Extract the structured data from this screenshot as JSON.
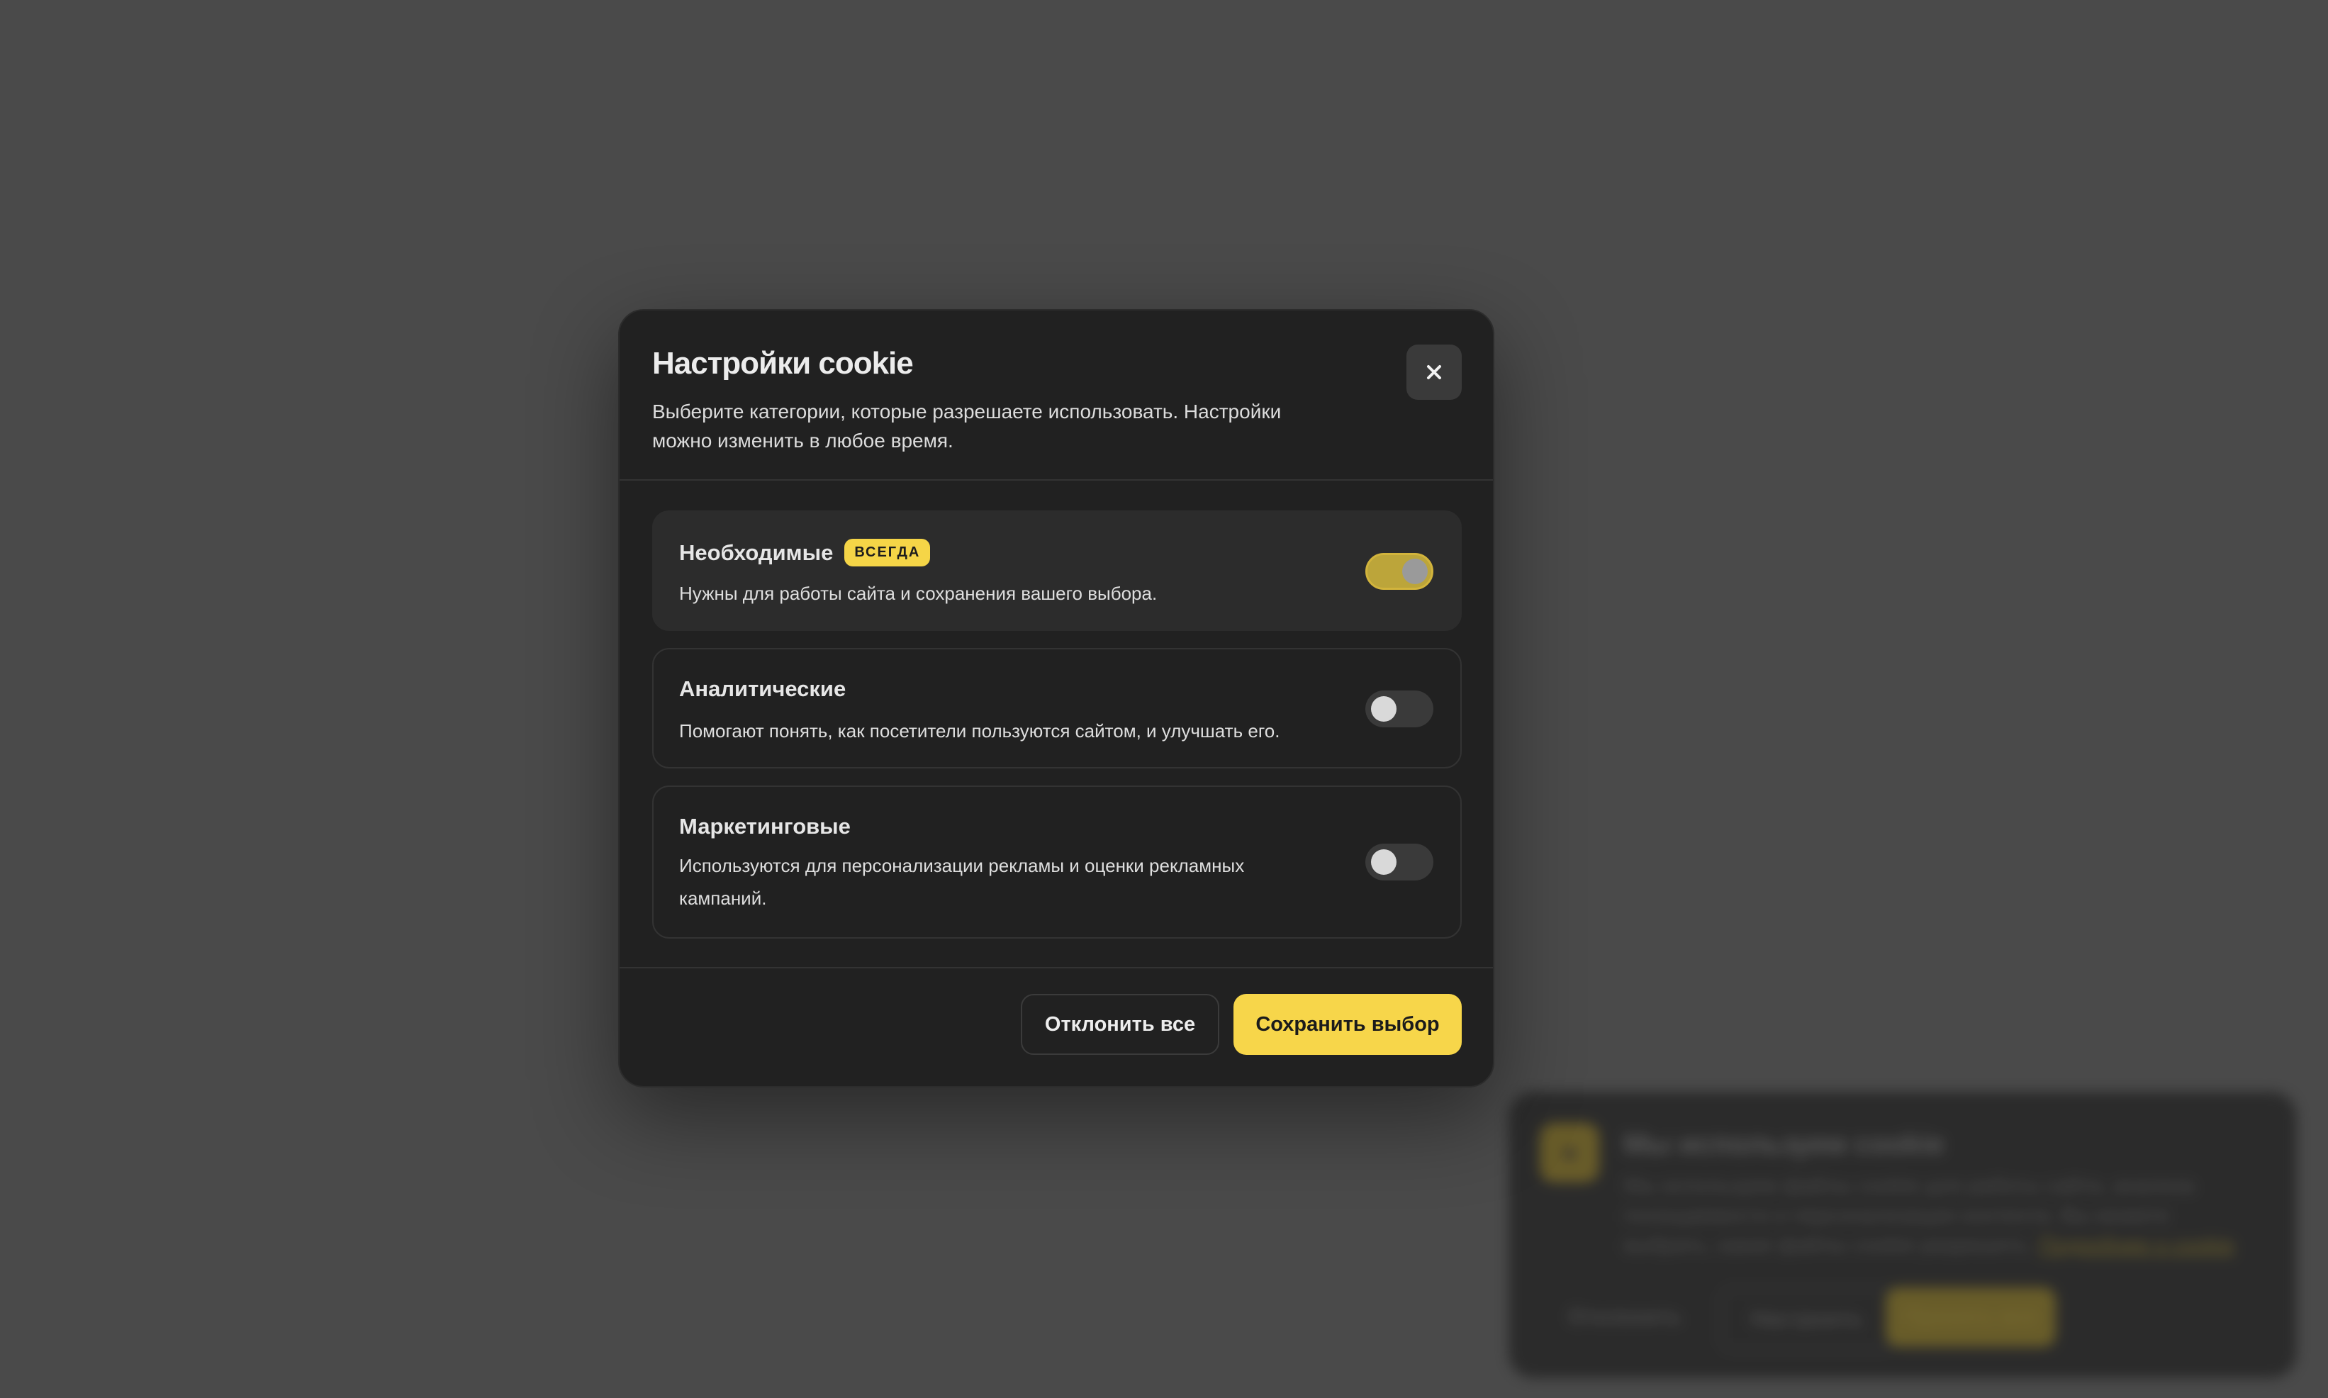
{
  "background_banner": {
    "icon": "cookie-icon",
    "title": "Мы используем cookie",
    "text": "Мы используем файлы cookie для работы сайта, анализа посещаемости и персонализации контента. Вы можете выбрать, какие файлы cookie разрешить.",
    "link_label": "Подробнее о cookie",
    "buttons": [
      "Отклонить",
      "Настроить",
      "Принять все"
    ]
  },
  "modal": {
    "title": "Настройки cookie",
    "subtitle": "Выберите категории, которые разрешаете использовать. Настройки можно изменить в любое время.",
    "close_icon": "close-icon",
    "categories": [
      {
        "title": "Необходимые",
        "badge": "ВСЕГДА",
        "description": "Нужны для работы сайта и сохранения вашего выбора.",
        "enabled": true,
        "locked": true
      },
      {
        "title": "Аналитические",
        "description": "Помогают понять, как посетители пользуются сайтом, и улучшать его.",
        "enabled": false
      },
      {
        "title": "Маркетинговые",
        "description": "Используются для персонализации рекламы и оценки рекламных кампаний.",
        "enabled": false
      }
    ],
    "buttons": {
      "decline_all": "Отклонить все",
      "save": "Сохранить выбор"
    }
  },
  "colors": {
    "accent": "#f7d64a",
    "modal_bg": "#212121",
    "page_bg": "#4a4a4a"
  }
}
